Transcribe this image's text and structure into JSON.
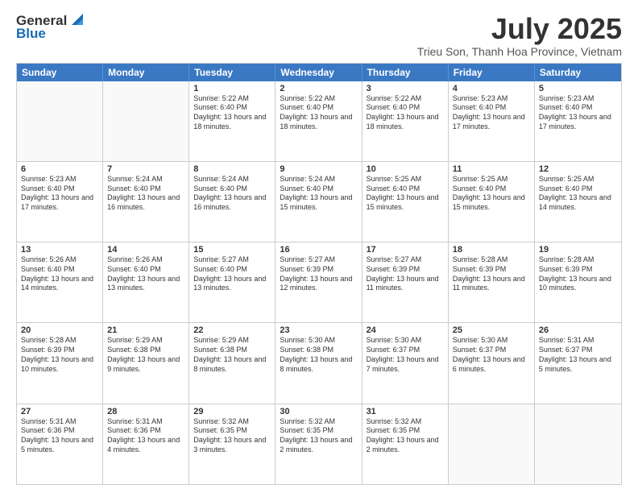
{
  "logo": {
    "general": "General",
    "blue": "Blue"
  },
  "title": "July 2025",
  "subtitle": "Trieu Son, Thanh Hoa Province, Vietnam",
  "header": {
    "days": [
      "Sunday",
      "Monday",
      "Tuesday",
      "Wednesday",
      "Thursday",
      "Friday",
      "Saturday"
    ]
  },
  "weeks": [
    [
      {
        "day": "",
        "info": ""
      },
      {
        "day": "",
        "info": ""
      },
      {
        "day": "1",
        "info": "Sunrise: 5:22 AM\nSunset: 6:40 PM\nDaylight: 13 hours and 18 minutes."
      },
      {
        "day": "2",
        "info": "Sunrise: 5:22 AM\nSunset: 6:40 PM\nDaylight: 13 hours and 18 minutes."
      },
      {
        "day": "3",
        "info": "Sunrise: 5:22 AM\nSunset: 6:40 PM\nDaylight: 13 hours and 18 minutes."
      },
      {
        "day": "4",
        "info": "Sunrise: 5:23 AM\nSunset: 6:40 PM\nDaylight: 13 hours and 17 minutes."
      },
      {
        "day": "5",
        "info": "Sunrise: 5:23 AM\nSunset: 6:40 PM\nDaylight: 13 hours and 17 minutes."
      }
    ],
    [
      {
        "day": "6",
        "info": "Sunrise: 5:23 AM\nSunset: 6:40 PM\nDaylight: 13 hours and 17 minutes."
      },
      {
        "day": "7",
        "info": "Sunrise: 5:24 AM\nSunset: 6:40 PM\nDaylight: 13 hours and 16 minutes."
      },
      {
        "day": "8",
        "info": "Sunrise: 5:24 AM\nSunset: 6:40 PM\nDaylight: 13 hours and 16 minutes."
      },
      {
        "day": "9",
        "info": "Sunrise: 5:24 AM\nSunset: 6:40 PM\nDaylight: 13 hours and 15 minutes."
      },
      {
        "day": "10",
        "info": "Sunrise: 5:25 AM\nSunset: 6:40 PM\nDaylight: 13 hours and 15 minutes."
      },
      {
        "day": "11",
        "info": "Sunrise: 5:25 AM\nSunset: 6:40 PM\nDaylight: 13 hours and 15 minutes."
      },
      {
        "day": "12",
        "info": "Sunrise: 5:25 AM\nSunset: 6:40 PM\nDaylight: 13 hours and 14 minutes."
      }
    ],
    [
      {
        "day": "13",
        "info": "Sunrise: 5:26 AM\nSunset: 6:40 PM\nDaylight: 13 hours and 14 minutes."
      },
      {
        "day": "14",
        "info": "Sunrise: 5:26 AM\nSunset: 6:40 PM\nDaylight: 13 hours and 13 minutes."
      },
      {
        "day": "15",
        "info": "Sunrise: 5:27 AM\nSunset: 6:40 PM\nDaylight: 13 hours and 13 minutes."
      },
      {
        "day": "16",
        "info": "Sunrise: 5:27 AM\nSunset: 6:39 PM\nDaylight: 13 hours and 12 minutes."
      },
      {
        "day": "17",
        "info": "Sunrise: 5:27 AM\nSunset: 6:39 PM\nDaylight: 13 hours and 11 minutes."
      },
      {
        "day": "18",
        "info": "Sunrise: 5:28 AM\nSunset: 6:39 PM\nDaylight: 13 hours and 11 minutes."
      },
      {
        "day": "19",
        "info": "Sunrise: 5:28 AM\nSunset: 6:39 PM\nDaylight: 13 hours and 10 minutes."
      }
    ],
    [
      {
        "day": "20",
        "info": "Sunrise: 5:28 AM\nSunset: 6:39 PM\nDaylight: 13 hours and 10 minutes."
      },
      {
        "day": "21",
        "info": "Sunrise: 5:29 AM\nSunset: 6:38 PM\nDaylight: 13 hours and 9 minutes."
      },
      {
        "day": "22",
        "info": "Sunrise: 5:29 AM\nSunset: 6:38 PM\nDaylight: 13 hours and 8 minutes."
      },
      {
        "day": "23",
        "info": "Sunrise: 5:30 AM\nSunset: 6:38 PM\nDaylight: 13 hours and 8 minutes."
      },
      {
        "day": "24",
        "info": "Sunrise: 5:30 AM\nSunset: 6:37 PM\nDaylight: 13 hours and 7 minutes."
      },
      {
        "day": "25",
        "info": "Sunrise: 5:30 AM\nSunset: 6:37 PM\nDaylight: 13 hours and 6 minutes."
      },
      {
        "day": "26",
        "info": "Sunrise: 5:31 AM\nSunset: 6:37 PM\nDaylight: 13 hours and 5 minutes."
      }
    ],
    [
      {
        "day": "27",
        "info": "Sunrise: 5:31 AM\nSunset: 6:36 PM\nDaylight: 13 hours and 5 minutes."
      },
      {
        "day": "28",
        "info": "Sunrise: 5:31 AM\nSunset: 6:36 PM\nDaylight: 13 hours and 4 minutes."
      },
      {
        "day": "29",
        "info": "Sunrise: 5:32 AM\nSunset: 6:35 PM\nDaylight: 13 hours and 3 minutes."
      },
      {
        "day": "30",
        "info": "Sunrise: 5:32 AM\nSunset: 6:35 PM\nDaylight: 13 hours and 2 minutes."
      },
      {
        "day": "31",
        "info": "Sunrise: 5:32 AM\nSunset: 6:35 PM\nDaylight: 13 hours and 2 minutes."
      },
      {
        "day": "",
        "info": ""
      },
      {
        "day": "",
        "info": ""
      }
    ]
  ]
}
